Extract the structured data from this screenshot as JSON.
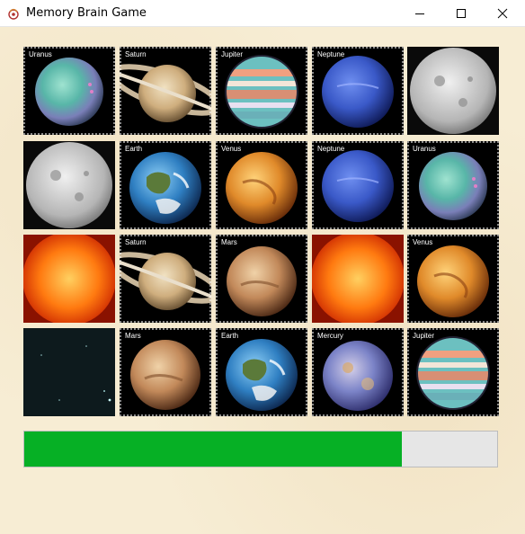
{
  "window": {
    "title": "Memory Brain Game",
    "controls": [
      "minimize-icon",
      "maximize-icon",
      "close-icon"
    ]
  },
  "cards": [
    {
      "label": "Uranus",
      "planet": "uranus"
    },
    {
      "label": "Saturn",
      "planet": "saturn"
    },
    {
      "label": "Jupiter",
      "planet": "jupiter"
    },
    {
      "label": "Neptune",
      "planet": "neptune"
    },
    {
      "label": "",
      "planet": "moon"
    },
    {
      "label": "",
      "planet": "moon"
    },
    {
      "label": "Earth",
      "planet": "earth"
    },
    {
      "label": "Venus",
      "planet": "venus"
    },
    {
      "label": "Neptune",
      "planet": "neptune"
    },
    {
      "label": "Uranus",
      "planet": "uranus"
    },
    {
      "label": "",
      "planet": "sun"
    },
    {
      "label": "Saturn",
      "planet": "saturn"
    },
    {
      "label": "Mars",
      "planet": "mars"
    },
    {
      "label": "",
      "planet": "sun"
    },
    {
      "label": "Venus",
      "planet": "venus"
    },
    {
      "label": "",
      "planet": "space"
    },
    {
      "label": "Mars",
      "planet": "mars"
    },
    {
      "label": "Earth",
      "planet": "earth"
    },
    {
      "label": "Mercury",
      "planet": "mercury"
    },
    {
      "label": "Jupiter",
      "planet": "jupiter"
    }
  ],
  "progress": {
    "value": 0.798,
    "fill_color": "#06b025",
    "track_color": "#e6e6e6"
  }
}
